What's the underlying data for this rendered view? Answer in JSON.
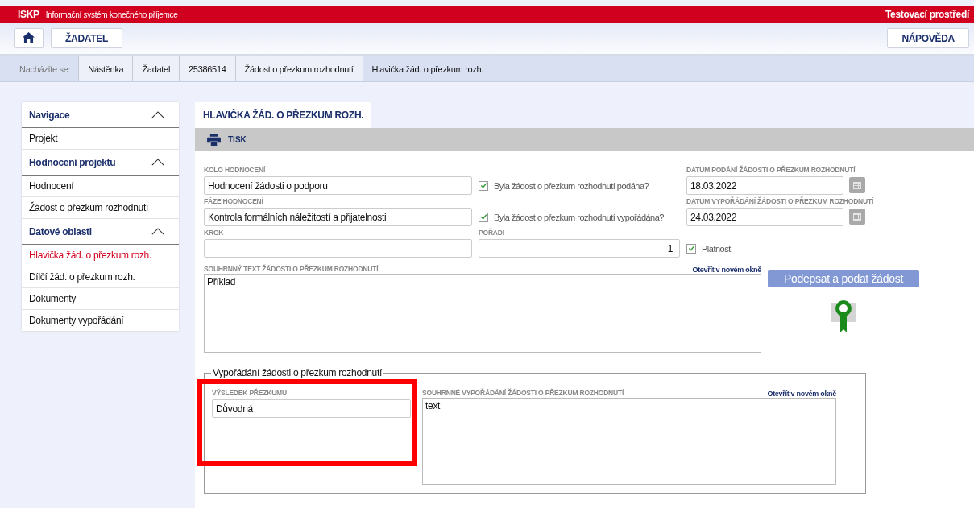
{
  "app": {
    "code": "ISKP",
    "name": "Informační systém konečného příjemce",
    "environment": "Testovací prostředí"
  },
  "header": {
    "buttons": [
      "ŽADATEL"
    ],
    "help": "NÁPOVĚDA"
  },
  "breadcrumb": {
    "label": "Nacházíte se:",
    "items": [
      {
        "label": "Nástěnka",
        "selected": false
      },
      {
        "label": "Žadatel",
        "selected": false
      },
      {
        "label": "25386514",
        "selected": false
      },
      {
        "label": "Žádost o přezkum rozhodnutí",
        "selected": false
      },
      {
        "label": "Hlavička žád. o přezkum rozh.",
        "selected": true
      }
    ]
  },
  "sidebar": {
    "sections": [
      {
        "title": "Navigace",
        "expanded": true,
        "items": [
          {
            "label": "Projekt",
            "selected": false
          }
        ]
      },
      {
        "title": "Hodnocení projektu",
        "expanded": true,
        "items": [
          {
            "label": "Hodnocení",
            "selected": false
          },
          {
            "label": "Žádost o přezkum rozhodnutí",
            "selected": false
          }
        ]
      },
      {
        "title": "Datové oblasti",
        "expanded": true,
        "items": [
          {
            "label": "Hlavička žád. o přezkum rozh.",
            "selected": true
          },
          {
            "label": "Dílčí žád. o přezkum rozh.",
            "selected": false
          },
          {
            "label": "Dokumenty",
            "selected": false
          },
          {
            "label": "Dokumenty vypořádání",
            "selected": false
          }
        ]
      }
    ]
  },
  "tab": {
    "label": "HLAVIČKA ŽÁD. O PŘEZKUM ROZH.",
    "selected": true
  },
  "toolbar": {
    "print": "TISK"
  },
  "form": {
    "kolo": {
      "label": "KOLO HODNOCENÍ",
      "value": "Hodnocení žádosti o podporu"
    },
    "podana": {
      "label": "Byla žádost o přezkum rozhodnutí podána?",
      "checked": true
    },
    "datum_podani": {
      "label": "DATUM PODÁNÍ ŽÁDOSTI O PŘEZKUM ROZHODNUTÍ",
      "value": "18.03.2022"
    },
    "faze": {
      "label": "FÁZE HODNOCENÍ",
      "value": "Kontrola formálních náležitostí a přijatelnosti"
    },
    "vyporadana": {
      "label": "Byla žádost o přezkum rozhodnutí vypořádána?",
      "checked": true
    },
    "datum_vyporadani": {
      "label": "DATUM VYPOŘÁDÁNÍ ŽÁDOSTI O PŘEZKUM ROZHODNUTÍ",
      "value": "24.03.2022"
    },
    "krok": {
      "label": "KROK"
    },
    "poradi": {
      "label": "POŘADÍ",
      "value": "1"
    },
    "platnost": {
      "label": "Platnost",
      "checked": true
    },
    "summary": {
      "label": "SOUHRNNÝ TEXT ŽÁDOSTI O PŘEZKUM ROZHODNUTÍ",
      "link": "Otevřít v novém okně",
      "value": "Příklad"
    },
    "sign_button": {
      "label": "Podepsat a podat žádost",
      "disabled": true
    }
  },
  "settlement": {
    "legend": "Vypořádání žádosti o přezkum rozhodnutí",
    "result": {
      "label": "VÝSLEDEK PŘEZKUMU",
      "value": "Důvodná"
    },
    "summary": {
      "label": "SOUHRNNÉ VYPOŘÁDÁNÍ ŽÁDOSTI O PŘEZKUM ROZHODNUTÍ",
      "link": "Otevřít v novém okně",
      "value": "text"
    }
  }
}
